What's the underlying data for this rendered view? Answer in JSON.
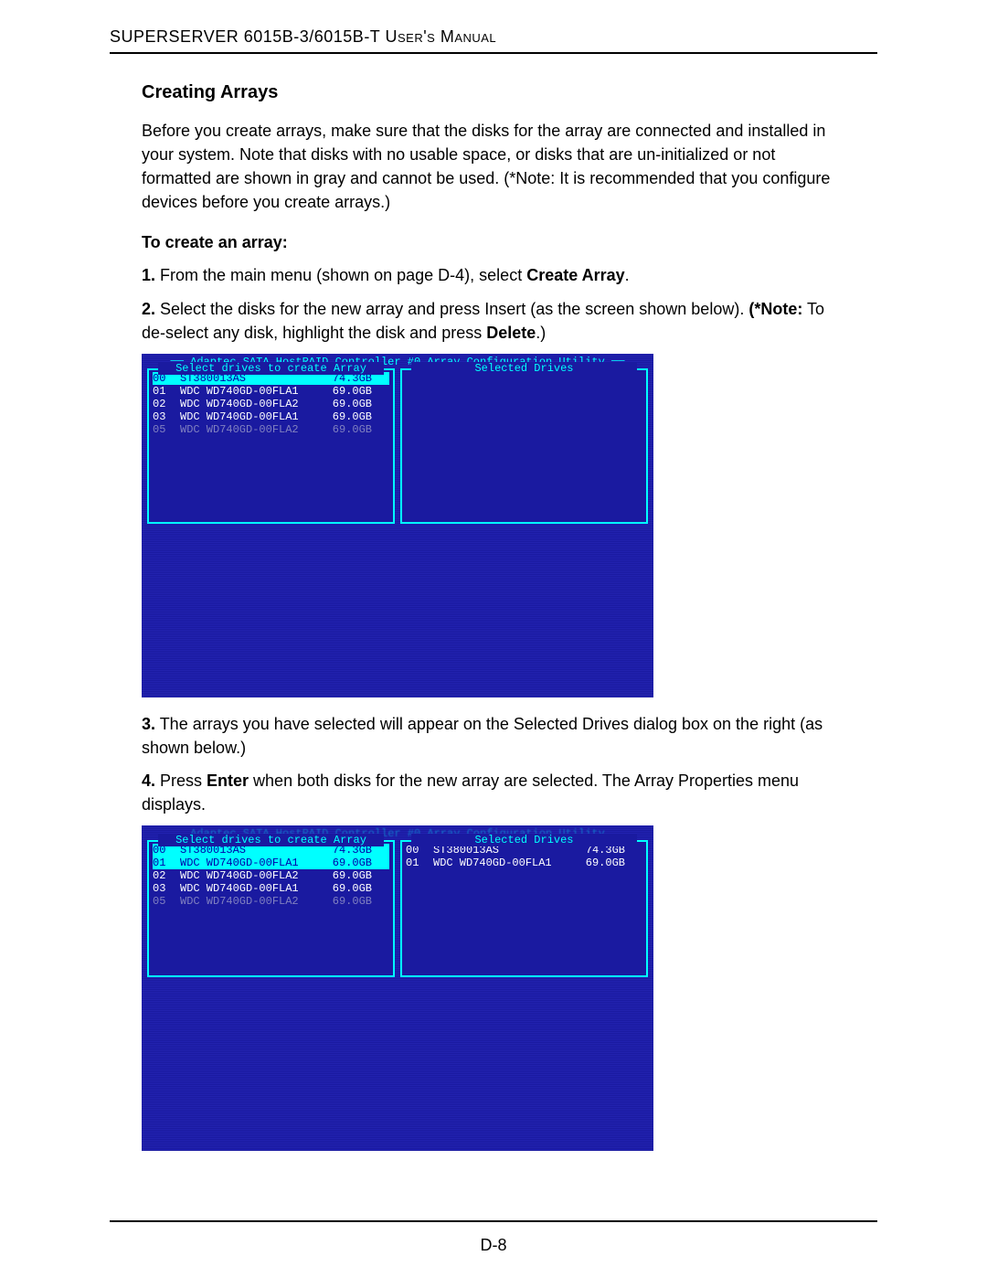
{
  "header": "SUPERSERVER 6015B-3/6015B-T User's Manual",
  "section_title": "Creating Arrays",
  "intro": "Before you create arrays, make sure that the disks for the array are connected and installed in your system. Note that disks with no usable space, or disks that are un-initialized or not formatted are shown in gray and cannot be used. (*Note: It is recommended that you configure devices before you create arrays.)",
  "subhead": "To create an array:",
  "step1_num": "1.",
  "step1_a": " From the main menu (shown on page D-4), select ",
  "step1_b": "Create Array",
  "step1_c": ".",
  "step2_num": "2.",
  "step2_a": " Select the disks for the new array and press Insert (as the screen shown below). ",
  "step2_b": "(*Note:",
  "step2_c": " To de-select any disk, highlight the disk and press ",
  "step2_d": "Delete",
  "step2_e": ".)",
  "bios1": {
    "title": "══ Adaptec SATA HostRAID Controller #0 Array Configuration Utility ══",
    "left_title": "Select drives to create Array",
    "right_title": "Selected Drives",
    "left_rows": [
      {
        "id": "00",
        "name": "ST380013AS",
        "size": "74.3GB",
        "sel": true,
        "dim": false
      },
      {
        "id": "01",
        "name": "WDC WD740GD-00FLA1",
        "size": "69.0GB",
        "sel": false,
        "dim": false
      },
      {
        "id": "02",
        "name": "WDC WD740GD-00FLA2",
        "size": "69.0GB",
        "sel": false,
        "dim": false
      },
      {
        "id": "03",
        "name": "WDC WD740GD-00FLA1",
        "size": "69.0GB",
        "sel": false,
        "dim": false
      },
      {
        "id": "05",
        "name": "WDC WD740GD-00FLA2",
        "size": "69.0GB",
        "sel": false,
        "dim": true
      }
    ],
    "right_rows": []
  },
  "step3_num": "3.",
  "step3_a": " The arrays you have selected will appear on the Selected Drives dialog box on the right (as shown below.)",
  "step4_num": "4.",
  "step4_a": " Press ",
  "step4_b": "Enter",
  "step4_c": " when both disks for the new array are selected. The Array Properties menu displays.",
  "bios2": {
    "title": "Adaptec SATA HostRAID Controller #0 Array Configuration Utility",
    "left_title": "Select drives to create Array",
    "right_title": "Selected Drives",
    "left_rows": [
      {
        "id": "00",
        "name": "ST380013AS",
        "size": "74.3GB",
        "sel": true,
        "dim": false
      },
      {
        "id": "01",
        "name": "WDC WD740GD-00FLA1",
        "size": "69.0GB",
        "sel": true,
        "dim": false
      },
      {
        "id": "02",
        "name": "WDC WD740GD-00FLA2",
        "size": "69.0GB",
        "sel": false,
        "dim": false
      },
      {
        "id": "03",
        "name": "WDC WD740GD-00FLA1",
        "size": "69.0GB",
        "sel": false,
        "dim": false
      },
      {
        "id": "05",
        "name": "WDC WD740GD-00FLA2",
        "size": "69.0GB",
        "sel": false,
        "dim": true
      }
    ],
    "right_rows": [
      {
        "id": "00",
        "name": "ST380013AS",
        "size": "74.3GB"
      },
      {
        "id": "01",
        "name": "WDC WD740GD-00FLA1",
        "size": "69.0GB"
      }
    ]
  },
  "pagenum": "D-8"
}
